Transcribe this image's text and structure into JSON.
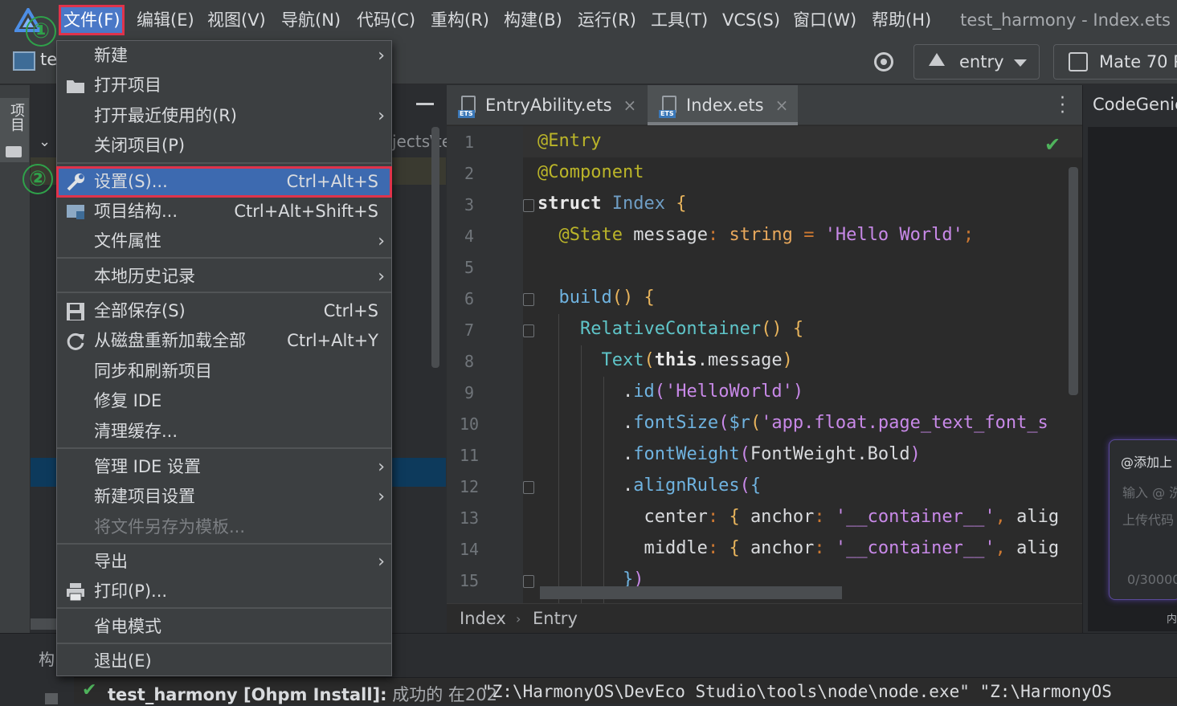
{
  "menubar": {
    "items": [
      "文件(F)",
      "编辑(E)",
      "视图(V)",
      "导航(N)",
      "代码(C)",
      "重构(R)",
      "构建(B)",
      "运行(R)",
      "工具(T)",
      "VCS(S)",
      "窗口(W)",
      "帮助(H)"
    ],
    "window_title": "test_harmony - Index.ets"
  },
  "markers": {
    "m1": "①",
    "m2": "②"
  },
  "toolbar": {
    "project_name": "te",
    "module_selector": "entry",
    "device_selector": "Mate 70 P"
  },
  "left_tool": {
    "project_label": "项目"
  },
  "project_panel": {
    "path_fragment": "jects\\te"
  },
  "file_menu": {
    "items": [
      {
        "label": "新建",
        "shortcut": "",
        "submenu": true,
        "disabled": false,
        "icon": ""
      },
      {
        "label": "打开项目",
        "shortcut": "",
        "submenu": false,
        "disabled": false,
        "icon": "folder-open-icon"
      },
      {
        "label": "打开最近使用的(R)",
        "shortcut": "",
        "submenu": true,
        "disabled": false,
        "icon": ""
      },
      {
        "label": "关闭项目(P)",
        "shortcut": "",
        "submenu": false,
        "disabled": false,
        "icon": ""
      },
      {
        "label": "设置(S)...",
        "shortcut": "Ctrl+Alt+S",
        "submenu": false,
        "disabled": false,
        "icon": "wrench-icon",
        "highlighted": true
      },
      {
        "label": "项目结构...",
        "shortcut": "Ctrl+Alt+Shift+S",
        "submenu": false,
        "disabled": false,
        "icon": "project-structure-icon"
      },
      {
        "label": "文件属性",
        "shortcut": "",
        "submenu": true,
        "disabled": false,
        "icon": ""
      },
      {
        "label": "本地历史记录",
        "shortcut": "",
        "submenu": true,
        "disabled": false,
        "icon": ""
      },
      {
        "label": "全部保存(S)",
        "shortcut": "Ctrl+S",
        "submenu": false,
        "disabled": false,
        "icon": "save-icon"
      },
      {
        "label": "从磁盘重新加载全部",
        "shortcut": "Ctrl+Alt+Y",
        "submenu": false,
        "disabled": false,
        "icon": "reload-icon"
      },
      {
        "label": "同步和刷新项目",
        "shortcut": "",
        "submenu": false,
        "disabled": false,
        "icon": ""
      },
      {
        "label": "修复 IDE",
        "shortcut": "",
        "submenu": false,
        "disabled": false,
        "icon": ""
      },
      {
        "label": "清理缓存...",
        "shortcut": "",
        "submenu": false,
        "disabled": false,
        "icon": ""
      },
      {
        "label": "管理 IDE 设置",
        "shortcut": "",
        "submenu": true,
        "disabled": false,
        "icon": ""
      },
      {
        "label": "新建项目设置",
        "shortcut": "",
        "submenu": true,
        "disabled": false,
        "icon": ""
      },
      {
        "label": "将文件另存为模板...",
        "shortcut": "",
        "submenu": false,
        "disabled": true,
        "icon": ""
      },
      {
        "label": "导出",
        "shortcut": "",
        "submenu": true,
        "disabled": false,
        "icon": ""
      },
      {
        "label": "打印(P)...",
        "shortcut": "",
        "submenu": false,
        "disabled": false,
        "icon": "print-icon"
      },
      {
        "label": "省电模式",
        "shortcut": "",
        "submenu": false,
        "disabled": false,
        "icon": ""
      },
      {
        "label": "退出(E)",
        "shortcut": "",
        "submenu": false,
        "disabled": false,
        "icon": ""
      }
    ]
  },
  "editor": {
    "tabs": [
      {
        "label": "EntryAbility.ets",
        "selected": false
      },
      {
        "label": "Index.ets",
        "selected": true
      }
    ],
    "file_badge": "ETS",
    "line_numbers": [
      "1",
      "2",
      "3",
      "4",
      "5",
      "6",
      "7",
      "8",
      "9",
      "10",
      "11",
      "12",
      "13",
      "14",
      "15"
    ],
    "breadcrumb": [
      "Index",
      "Entry"
    ]
  },
  "right_panel": {
    "title": "CodeGenie",
    "add_context": "@添加上",
    "input_placeholder": "输入 @ 洗",
    "upload_hint": "上传代码",
    "counter": "0/30000",
    "footer": "内"
  },
  "bottom": {
    "build_label": "构",
    "status": "test_harmony [Ohpm Install]:",
    "status_detail": "成功的 在202",
    "console": "\"Z:\\HarmonyOS\\DevEco Studio\\tools\\node\\node.exe\" \"Z:\\HarmonyOS"
  },
  "colors": {
    "accent_red": "#e0334b",
    "marker_green": "#2fa14a",
    "selection_blue": "#3d6ab0"
  }
}
